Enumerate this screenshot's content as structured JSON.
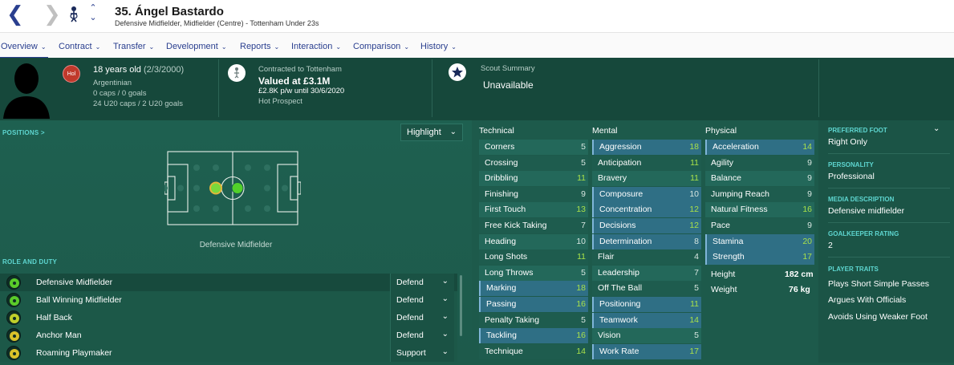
{
  "header": {
    "back_icon": "chevron-left-icon",
    "forward_icon": "chevron-right-icon",
    "up_glyph": "⌃",
    "down_glyph": "⌄",
    "player_name": "35. Ángel Bastardo",
    "player_subtitle": "Defensive Midfielder, Midfielder (Centre) - Tottenham Under 23s"
  },
  "tabs": [
    {
      "label": "Overview"
    },
    {
      "label": "Contract"
    },
    {
      "label": "Transfer"
    },
    {
      "label": "Development"
    },
    {
      "label": "Reports"
    },
    {
      "label": "Interaction"
    },
    {
      "label": "Comparison"
    },
    {
      "label": "History"
    }
  ],
  "info": {
    "nationality_badge": "Hol",
    "age_line_main": "18 years old",
    "age_line_dob": "(2/3/2000)",
    "nationality": "Argentinian",
    "caps": "0 caps / 0 goals",
    "u20_caps": "24 U20 caps / 2 U20 goals",
    "contract_label": "Contracted to Tottenham",
    "value": "Valued at £3.1M",
    "wage": "£2.8K p/w until 30/6/2020",
    "tag": "Hot Prospect",
    "scout_label": "Scout Summary",
    "scout_value": "Unavailable"
  },
  "positions": {
    "label": "POSITIONS",
    "label_arrow": ">",
    "highlight_label": "Highlight",
    "caption": "Defensive Midfielder"
  },
  "roles": {
    "label": "ROLE AND DUTY",
    "items": [
      {
        "name": "Defensive Midfielder",
        "duty": "Defend"
      },
      {
        "name": "Ball Winning Midfielder",
        "duty": "Defend"
      },
      {
        "name": "Half Back",
        "duty": "Defend"
      },
      {
        "name": "Anchor Man",
        "duty": "Defend"
      },
      {
        "name": "Roaming Playmaker",
        "duty": "Support"
      }
    ]
  },
  "attributes": {
    "technical": {
      "title": "Technical",
      "items": [
        {
          "name": "Corners",
          "value": "5"
        },
        {
          "name": "Crossing",
          "value": "5"
        },
        {
          "name": "Dribbling",
          "value": "11"
        },
        {
          "name": "Finishing",
          "value": "9"
        },
        {
          "name": "First Touch",
          "value": "13"
        },
        {
          "name": "Free Kick Taking",
          "value": "7"
        },
        {
          "name": "Heading",
          "value": "10"
        },
        {
          "name": "Long Shots",
          "value": "11"
        },
        {
          "name": "Long Throws",
          "value": "5"
        },
        {
          "name": "Marking",
          "value": "18"
        },
        {
          "name": "Passing",
          "value": "16"
        },
        {
          "name": "Penalty Taking",
          "value": "5"
        },
        {
          "name": "Tackling",
          "value": "16"
        },
        {
          "name": "Technique",
          "value": "14"
        }
      ]
    },
    "mental": {
      "title": "Mental",
      "items": [
        {
          "name": "Aggression",
          "value": "18"
        },
        {
          "name": "Anticipation",
          "value": "11"
        },
        {
          "name": "Bravery",
          "value": "11"
        },
        {
          "name": "Composure",
          "value": "10"
        },
        {
          "name": "Concentration",
          "value": "12"
        },
        {
          "name": "Decisions",
          "value": "12"
        },
        {
          "name": "Determination",
          "value": "8"
        },
        {
          "name": "Flair",
          "value": "4"
        },
        {
          "name": "Leadership",
          "value": "7"
        },
        {
          "name": "Off The Ball",
          "value": "5"
        },
        {
          "name": "Positioning",
          "value": "11"
        },
        {
          "name": "Teamwork",
          "value": "14"
        },
        {
          "name": "Vision",
          "value": "5"
        },
        {
          "name": "Work Rate",
          "value": "17"
        }
      ]
    },
    "physical": {
      "title": "Physical",
      "items": [
        {
          "name": "Acceleration",
          "value": "14"
        },
        {
          "name": "Agility",
          "value": "9"
        },
        {
          "name": "Balance",
          "value": "9"
        },
        {
          "name": "Jumping Reach",
          "value": "9"
        },
        {
          "name": "Natural Fitness",
          "value": "16"
        },
        {
          "name": "Pace",
          "value": "9"
        },
        {
          "name": "Stamina",
          "value": "20"
        },
        {
          "name": "Strength",
          "value": "17"
        }
      ],
      "height_label": "Height",
      "height_value": "182 cm",
      "weight_label": "Weight",
      "weight_value": "76 kg"
    }
  },
  "side": {
    "preferred_foot_label": "PREFERRED FOOT",
    "preferred_foot": "Right Only",
    "personality_label": "PERSONALITY",
    "personality": "Professional",
    "media_label": "MEDIA DESCRIPTION",
    "media": "Defensive midfielder",
    "gk_label": "GOALKEEPER RATING",
    "gk": "2",
    "traits_label": "PLAYER TRAITS",
    "traits": [
      "Plays Short Simple Passes",
      "Argues With Officials",
      "Avoids Using Weaker Foot"
    ]
  },
  "colors": {
    "accent": "#2a3f8f",
    "highlight_value": "#a8e04a",
    "section_label": "#5ed6d0",
    "panel_bg": "#1d5a4b"
  }
}
